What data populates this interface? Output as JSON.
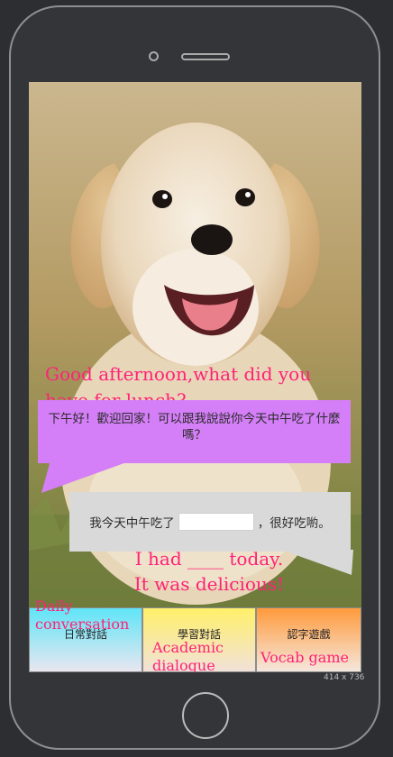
{
  "device": {
    "size_label": "414 x 736"
  },
  "dialog": {
    "greeting_en": "Good afternoon,what did you have for lunch?",
    "greeting_zh": "下午好！歡迎回家！可以跟我說說你今天中午吃了什麼嗎？",
    "reply_prefix_zh": "我今天中午吃了",
    "reply_suffix_zh": "，很好吃喲。",
    "reply_input_value": "",
    "reply_en": "I had ____ today.\nIt was delicious!"
  },
  "tabs": [
    {
      "label": "日常對話",
      "note": "Daily\nconversation"
    },
    {
      "label": "學習對話",
      "note": "Academic\ndialogue"
    },
    {
      "label": "認字遊戲",
      "note": "Vocab game"
    }
  ],
  "colors": {
    "annotation": "#ff2277",
    "bubble_question": "#d47ff7",
    "bubble_answer": "#d9d9d9",
    "tab_daily": "#5fe5f7",
    "tab_academic": "#fff06a",
    "tab_vocab": "#ff9a3c"
  },
  "icons": {
    "photo": "puppy-photo"
  }
}
